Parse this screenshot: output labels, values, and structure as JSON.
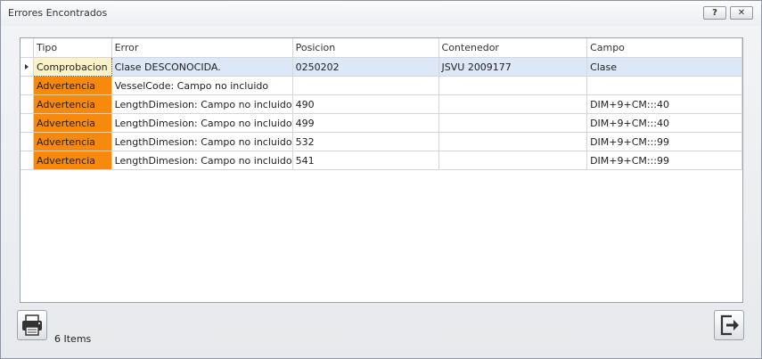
{
  "window": {
    "title": "Errores Encontrados",
    "help_label": "?",
    "close_label": "✕"
  },
  "grid": {
    "columns": [
      "Tipo",
      "Error",
      "Posicion",
      "Contenedor",
      "Campo"
    ],
    "rows": [
      {
        "tipo": "Comprobacion",
        "error": "Clase DESCONOCIDA.",
        "posicion": "0250202",
        "contenedor": "JSVU 2009177",
        "campo": "Clase"
      },
      {
        "tipo": "Advertencia",
        "error": "VesselCode: Campo no incluido",
        "posicion": "",
        "contenedor": "",
        "campo": ""
      },
      {
        "tipo": "Advertencia",
        "error": "LengthDimesion: Campo no incluido",
        "posicion": "490",
        "contenedor": "",
        "campo": "DIM+9+CM:::40"
      },
      {
        "tipo": "Advertencia",
        "error": "LengthDimesion: Campo no incluido",
        "posicion": "499",
        "contenedor": "",
        "campo": "DIM+9+CM:::40"
      },
      {
        "tipo": "Advertencia",
        "error": "LengthDimesion: Campo no incluido",
        "posicion": "532",
        "contenedor": "",
        "campo": "DIM+9+CM:::99"
      },
      {
        "tipo": "Advertencia",
        "error": "LengthDimesion: Campo no incluido",
        "posicion": "541",
        "contenedor": "",
        "campo": "DIM+9+CM:::99"
      }
    ]
  },
  "footer": {
    "item_count": "6 Items",
    "print_icon": "printer-icon",
    "exit_icon": "exit-icon"
  },
  "colors": {
    "warning": "#f7890c",
    "check": "#fbf2c8",
    "selected_row": "#dce7f7"
  }
}
